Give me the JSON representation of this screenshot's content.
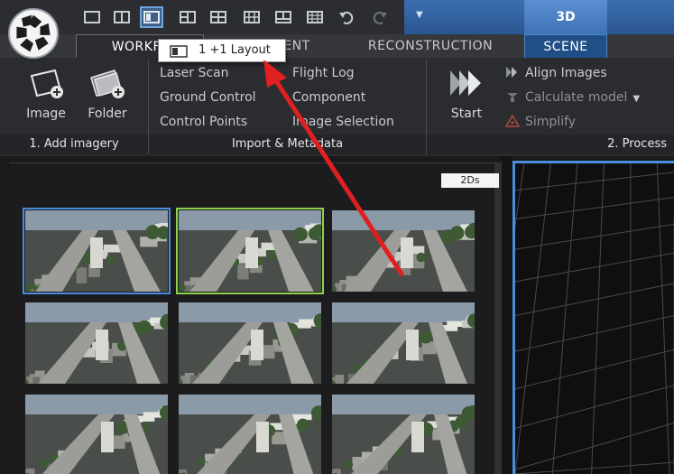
{
  "quick_access": {
    "layout_icons": [
      "single-view-layout-icon",
      "two-column-layout-icon",
      "one-plus-one-layout-icon",
      "left-panel-layout-icon",
      "four-grid-layout-icon",
      "six-grid-layout-icon",
      "top-bottom-layout-icon",
      "nine-grid-layout-icon"
    ],
    "selected_layout": "one-plus-one-layout-icon",
    "undo_icon": "undo-icon",
    "redo_icon": "redo-icon",
    "dropdown_glyph": "▼"
  },
  "contextual_tab": "3D",
  "tabs": {
    "workflow": "WORKFL",
    "alignment_partial": "ENT",
    "reconstruction": "RECONSTRUCTION",
    "scene": "SCENE"
  },
  "tooltip": {
    "text": "1 +1 Layout",
    "icon": "one-plus-one-layout-icon"
  },
  "ribbon": {
    "add_imagery": {
      "image_label": "Image",
      "folder_label": "Folder",
      "footer": "1. Add imagery"
    },
    "import_metadata": {
      "laser_scan": "Laser Scan",
      "ground_control": "Ground Control",
      "control_points": "Control Points",
      "flight_log": "Flight Log",
      "component": "Component",
      "image_selection": "Image Selection",
      "footer": "Import & Metadata"
    },
    "process": {
      "start_label": "Start",
      "align_images": "Align Images",
      "calculate_model": "Calculate model",
      "simplify": "Simplify",
      "footer": "2. Process"
    }
  },
  "gallery": {
    "view_badge": "2Ds",
    "thumbnails": [
      {
        "selection": "blue"
      },
      {
        "selection": "green"
      },
      {
        "selection": "none"
      },
      {
        "selection": "none"
      },
      {
        "selection": "none"
      },
      {
        "selection": "none"
      },
      {
        "selection": "none"
      },
      {
        "selection": "none"
      },
      {
        "selection": "none"
      }
    ]
  },
  "colors": {
    "accent_blue": "#4a8de0",
    "selection_green": "#8fd24a",
    "annotation_arrow": "#e02020",
    "ribbon_bg": "#2a2c30"
  }
}
